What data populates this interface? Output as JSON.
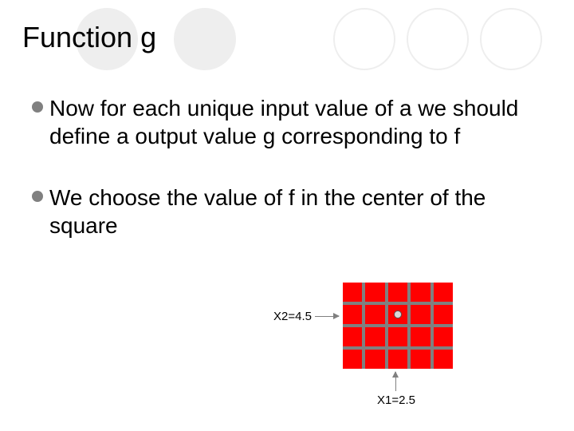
{
  "title": "Function g",
  "bullets": [
    "Now for each unique input value of a we should define a output value g corresponding to f",
    "We choose the value of f in the center of the square"
  ],
  "grid": {
    "rows": 4,
    "cols": 5,
    "marker_row": 1,
    "marker_col": 2
  },
  "labels": {
    "x2": "X2=4.5",
    "x1": "X1=2.5"
  },
  "colors": {
    "cell": "#ff0000",
    "grid_gap": "#808080",
    "bullet": "#808080",
    "deco_fill": "#eeeeee"
  }
}
